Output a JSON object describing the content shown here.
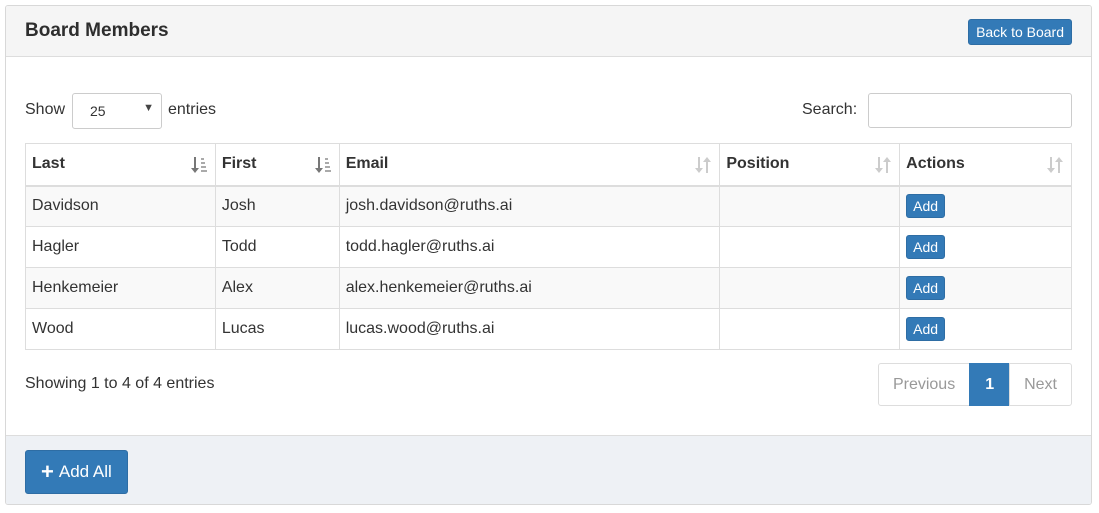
{
  "panel": {
    "title": "Board Members",
    "back_label": "Back to Board"
  },
  "controls": {
    "show_label": "Show",
    "length_value": "25",
    "entries_label": "entries",
    "search_label": "Search:",
    "search_value": ""
  },
  "table": {
    "columns": [
      "Last",
      "First",
      "Email",
      "Position",
      "Actions"
    ],
    "rows": [
      {
        "last": "Davidson",
        "first": "Josh",
        "email": "josh.davidson@ruths.ai",
        "position": "",
        "action": "Add"
      },
      {
        "last": "Hagler",
        "first": "Todd",
        "email": "todd.hagler@ruths.ai",
        "position": "",
        "action": "Add"
      },
      {
        "last": "Henkemeier",
        "first": "Alex",
        "email": "alex.henkemeier@ruths.ai",
        "position": "",
        "action": "Add"
      },
      {
        "last": "Wood",
        "first": "Lucas",
        "email": "lucas.wood@ruths.ai",
        "position": "",
        "action": "Add"
      }
    ]
  },
  "info": "Showing 1 to 4 of 4 entries",
  "pagination": {
    "previous": "Previous",
    "current": "1",
    "next": "Next"
  },
  "footer": {
    "add_all_label": "Add All",
    "add_all_icon": "plus-icon"
  },
  "colors": {
    "primary": "#337ab7",
    "heading_bg": "#f5f5f5",
    "footer_bg": "#eef1f5"
  }
}
